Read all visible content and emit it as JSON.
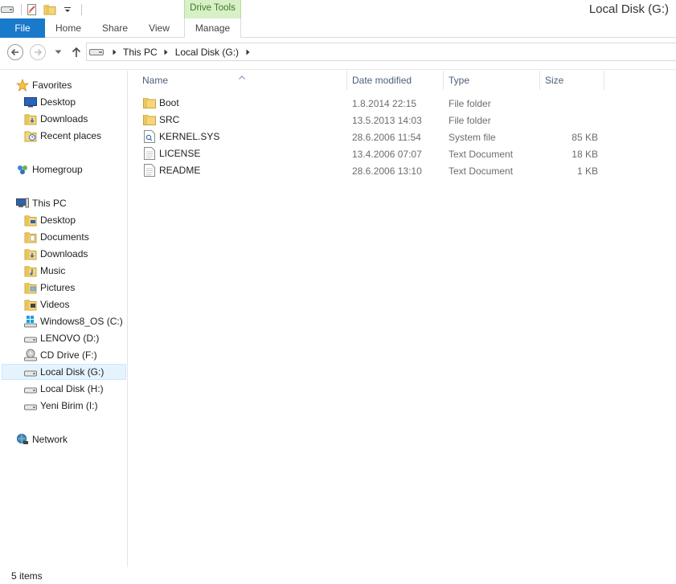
{
  "window": {
    "title": "Local Disk (G:)"
  },
  "ribbon": {
    "contextual_group": "Drive Tools",
    "tabs": {
      "file": "File",
      "home": "Home",
      "share": "Share",
      "view": "View",
      "manage": "Manage"
    },
    "accent_color": "#1979ca",
    "contextual_color": "#d7f0c6"
  },
  "address_bar": {
    "crumbs": [
      "This PC",
      "Local Disk (G:)"
    ]
  },
  "nav_pane": {
    "favorites": {
      "label": "Favorites",
      "items": [
        "Desktop",
        "Downloads",
        "Recent places"
      ]
    },
    "homegroup": {
      "label": "Homegroup"
    },
    "this_pc": {
      "label": "This PC",
      "items": [
        "Desktop",
        "Documents",
        "Downloads",
        "Music",
        "Pictures",
        "Videos",
        "Windows8_OS (C:)",
        "LENOVO (D:)",
        "CD Drive (F:)",
        "Local Disk (G:)",
        "Local Disk (H:)",
        "Yeni Birim (I:)"
      ],
      "selected": "Local Disk (G:)"
    },
    "network": {
      "label": "Network"
    }
  },
  "columns": {
    "name": "Name",
    "date": "Date modified",
    "type": "Type",
    "size": "Size"
  },
  "files": [
    {
      "name": "Boot",
      "date": "1.8.2014 22:15",
      "type": "File folder",
      "size": "",
      "icon": "folder-icon"
    },
    {
      "name": "SRC",
      "date": "13.5.2013 14:03",
      "type": "File folder",
      "size": "",
      "icon": "folder-icon"
    },
    {
      "name": "KERNEL.SYS",
      "date": "28.6.2006 11:54",
      "type": "System file",
      "size": "85 KB",
      "icon": "system-file-icon"
    },
    {
      "name": "LICENSE",
      "date": "13.4.2006 07:07",
      "type": "Text Document",
      "size": "18 KB",
      "icon": "text-document-icon"
    },
    {
      "name": "README",
      "date": "28.6.2006 13:10",
      "type": "Text Document",
      "size": "1 KB",
      "icon": "text-document-icon"
    }
  ],
  "status": {
    "item_count": "5 items"
  }
}
